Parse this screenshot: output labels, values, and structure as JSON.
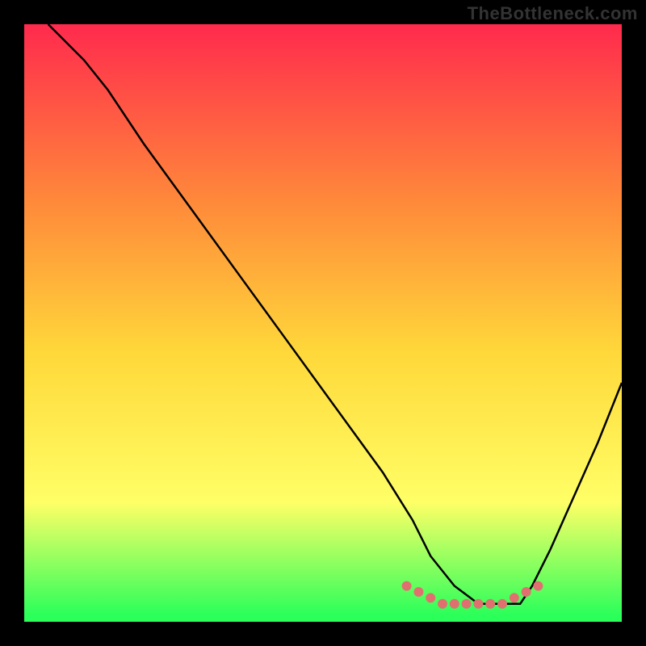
{
  "watermark": "TheBottleneck.com",
  "chart_data": {
    "type": "line",
    "title": "",
    "xlabel": "",
    "ylabel": "",
    "xlim": [
      0,
      100
    ],
    "ylim": [
      0,
      100
    ],
    "background_gradient": {
      "top": "#ff2a4d",
      "upper_mid": "#ff8a3a",
      "mid": "#ffd83a",
      "lower_mid": "#ffff66",
      "bottom": "#2aff5a"
    },
    "series": [
      {
        "name": "curve",
        "color": "#000000",
        "x": [
          4,
          6,
          8,
          10,
          14,
          20,
          28,
          36,
          44,
          52,
          60,
          65,
          68,
          72,
          76,
          80,
          83,
          85,
          88,
          92,
          96,
          100
        ],
        "values": [
          100,
          98,
          96,
          94,
          89,
          80,
          69,
          58,
          47,
          36,
          25,
          17,
          11,
          6,
          3,
          3,
          3,
          6,
          12,
          21,
          30,
          40
        ]
      }
    ],
    "optimum_band": {
      "color": "#e07070",
      "x": [
        64,
        66,
        68,
        70,
        72,
        74,
        76,
        78,
        80,
        82,
        84,
        86
      ],
      "values": [
        6,
        5,
        4,
        3,
        3,
        3,
        3,
        3,
        3,
        4,
        5,
        6
      ]
    }
  }
}
